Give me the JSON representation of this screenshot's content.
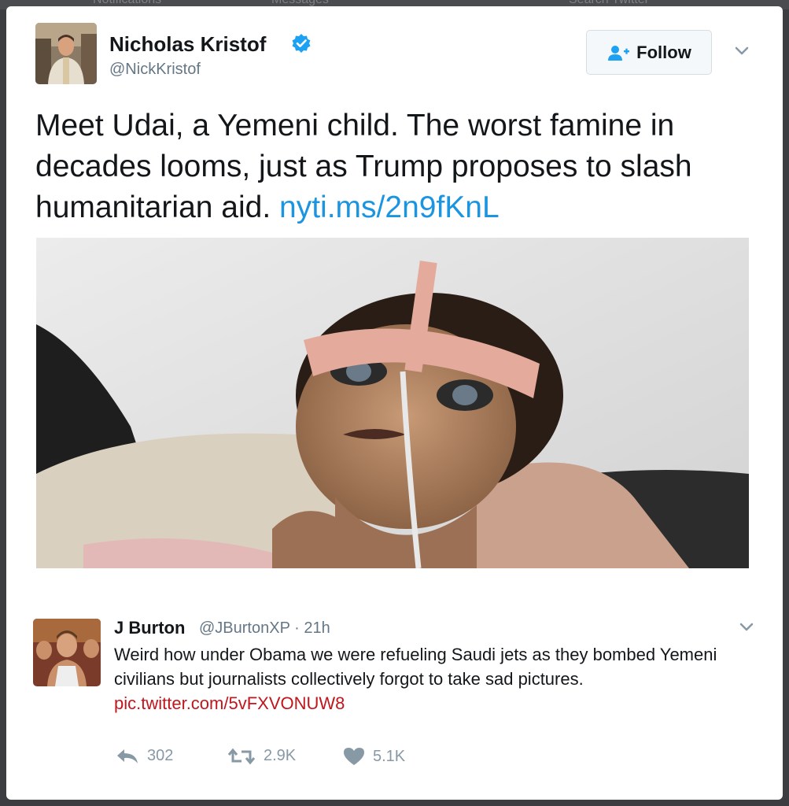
{
  "background": {
    "nav_items": [
      "Notifications",
      "Messages",
      "Search Twitter"
    ]
  },
  "tweet": {
    "author_name": "Nicholas Kristof",
    "author_handle": "@NickKristof",
    "verified": true,
    "follow_label": "Follow",
    "text": "Meet Udai, a Yemeni child. The worst famine in decades looms, just as Trump proposes to slash humanitarian aid.",
    "link": "nyti.ms/2n9fKnL",
    "media": "photo-of-malnourished-child"
  },
  "reply": {
    "author_name": "J Burton",
    "author_handle": "@JBurtonXP · 21h",
    "text": "Weird how under Obama we were refueling Saudi jets as they bombed Yemeni civilians but journalists collectively forgot to take sad pictures.",
    "link": "pic.twitter.com/5vFXVONUW8",
    "stats": {
      "replies": "302",
      "retweets": "2.9K",
      "likes": "5.1K"
    }
  },
  "colors": {
    "link_blue": "#1b95e0",
    "reply_link": "#c0161c",
    "verified": "#1da1f2",
    "muted": "#657786"
  }
}
